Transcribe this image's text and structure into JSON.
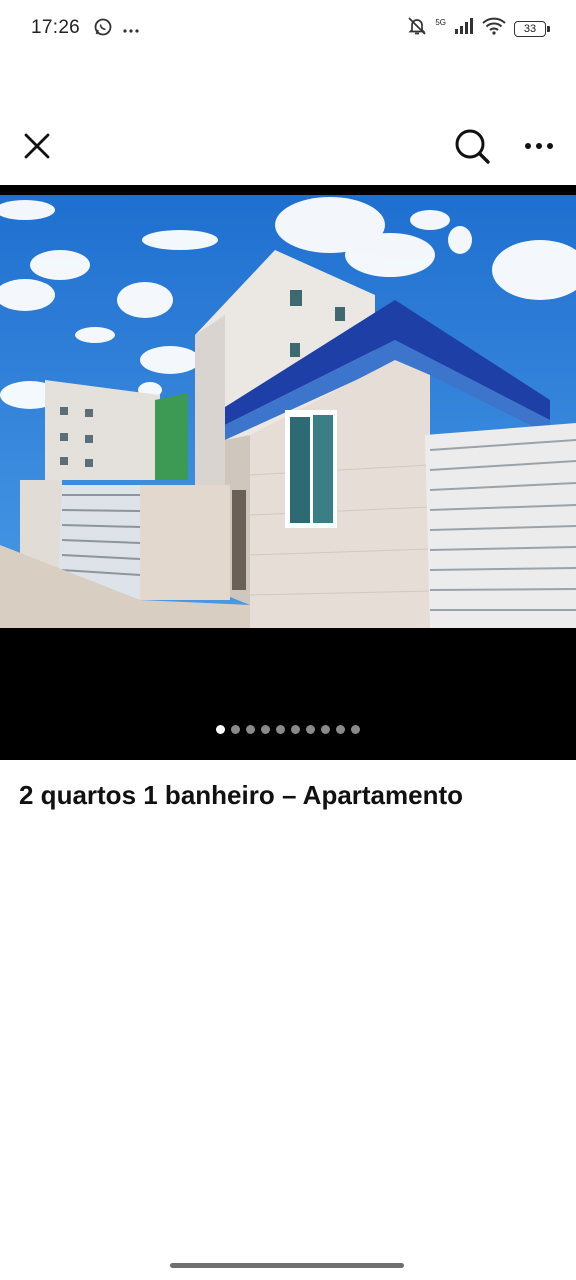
{
  "status_bar": {
    "time": "17:26",
    "network_label": "5G",
    "battery_level": "33"
  },
  "app_bar": {
    "close_icon": "close-icon",
    "search_icon": "search-icon",
    "more_icon": "more-horizontal-icon"
  },
  "gallery": {
    "image_count": 10,
    "active_index": 0
  },
  "listing": {
    "title": "2 quartos 1 banheiro – Apartamento"
  },
  "colors": {
    "sky": "#2f7fd6",
    "tile_blue": "#1f3fa8",
    "building_white": "#e9e6e2",
    "building_green": "#3e9b52"
  }
}
